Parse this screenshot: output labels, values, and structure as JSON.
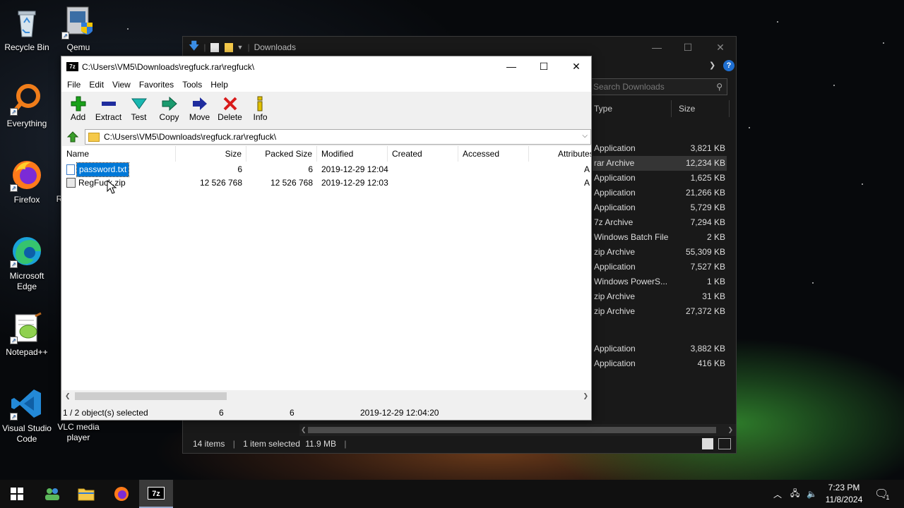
{
  "desktop": {
    "icons": [
      {
        "label": "Recycle Bin",
        "icon": "recycle-bin-icon"
      },
      {
        "label": "Qemu",
        "icon": "qemu-shield-icon"
      },
      {
        "label": "Everything",
        "icon": "everything-search-icon"
      },
      {
        "label": "Firefox",
        "icon": "firefox-icon"
      },
      {
        "label": "R",
        "icon": "partial-icon"
      },
      {
        "label": "Microsoft Edge",
        "icon": "edge-icon"
      },
      {
        "label": "Notepad++",
        "icon": "notepadpp-icon"
      },
      {
        "label": "Visual Studio Code",
        "icon": "vscode-icon"
      },
      {
        "label": "VLC media player",
        "icon": "vlc-icon"
      }
    ]
  },
  "explorer": {
    "title": "Downloads",
    "search_placeholder": "Search Downloads",
    "columns": {
      "type": "Type",
      "size": "Size"
    },
    "rows": [
      {
        "type": "Application",
        "size": "3,821 KB",
        "selected": false
      },
      {
        "type": "rar Archive",
        "size": "12,234 KB",
        "selected": true
      },
      {
        "type": "Application",
        "size": "1,625 KB",
        "selected": false
      },
      {
        "type": "Application",
        "size": "21,266 KB",
        "selected": false
      },
      {
        "type": "Application",
        "size": "5,729 KB",
        "selected": false
      },
      {
        "type": "7z Archive",
        "size": "7,294 KB",
        "selected": false
      },
      {
        "type": "Windows Batch File",
        "size": "2 KB",
        "selected": false
      },
      {
        "type": "zip Archive",
        "size": "55,309 KB",
        "selected": false
      },
      {
        "type": "Application",
        "size": "7,527 KB",
        "selected": false
      },
      {
        "type": "Windows PowerS...",
        "size": "1 KB",
        "selected": false
      },
      {
        "type": "zip Archive",
        "size": "31 KB",
        "selected": false
      },
      {
        "type": "zip Archive",
        "size": "27,372 KB",
        "selected": false
      },
      {
        "type": "Application",
        "size": "3,882 KB",
        "selected": false
      },
      {
        "type": "Application",
        "size": "416 KB",
        "selected": false
      }
    ],
    "status": {
      "items": "14 items",
      "selected": "1 item selected",
      "size": "11.9 MB"
    }
  },
  "zip": {
    "title": "C:\\Users\\VM5\\Downloads\\regfuck.rar\\regfuck\\",
    "menu": [
      "File",
      "Edit",
      "View",
      "Favorites",
      "Tools",
      "Help"
    ],
    "toolbar": [
      {
        "label": "Add",
        "icon": "add-plus-icon",
        "color": "#1aa11a"
      },
      {
        "label": "Extract",
        "icon": "extract-minus-icon",
        "color": "#1f2d9e"
      },
      {
        "label": "Test",
        "icon": "test-check-icon",
        "color": "#19b7b0"
      },
      {
        "label": "Copy",
        "icon": "copy-arrow-icon",
        "color": "#1a9a6e"
      },
      {
        "label": "Move",
        "icon": "move-arrow-icon",
        "color": "#1f2d9e"
      },
      {
        "label": "Delete",
        "icon": "delete-x-icon",
        "color": "#d91c1c"
      },
      {
        "label": "Info",
        "icon": "info-i-icon",
        "color": "#8a8a00"
      }
    ],
    "address": "C:\\Users\\VM5\\Downloads\\regfuck.rar\\regfuck\\",
    "columns": [
      "Name",
      "Size",
      "Packed Size",
      "Modified",
      "Created",
      "Accessed",
      "Attributes"
    ],
    "files": [
      {
        "name": "password.txt",
        "size": "6",
        "packed": "6",
        "modified": "2019-12-29 12:04",
        "attr": "A",
        "selected": true,
        "icon": "text-file-icon"
      },
      {
        "name": "RegFuck.zip",
        "size": "12 526 768",
        "packed": "12 526 768",
        "modified": "2019-12-29 12:03",
        "attr": "A",
        "selected": false,
        "icon": "zip-file-icon"
      }
    ],
    "status": {
      "selection": "1 / 2 object(s) selected",
      "size": "6",
      "packed": "6",
      "modified": "2019-12-29 12:04:20"
    }
  },
  "taskbar": {
    "apps": [
      {
        "name": "start",
        "icon": "windows-start-icon"
      },
      {
        "name": "task-view",
        "icon": "people-icon"
      },
      {
        "name": "file-explorer",
        "icon": "folder-icon"
      },
      {
        "name": "firefox",
        "icon": "firefox-icon"
      },
      {
        "name": "7zip",
        "icon": "7zip-icon",
        "active": true
      }
    ],
    "time": "7:23 PM",
    "date": "11/8/2024",
    "notification_count": "1"
  }
}
